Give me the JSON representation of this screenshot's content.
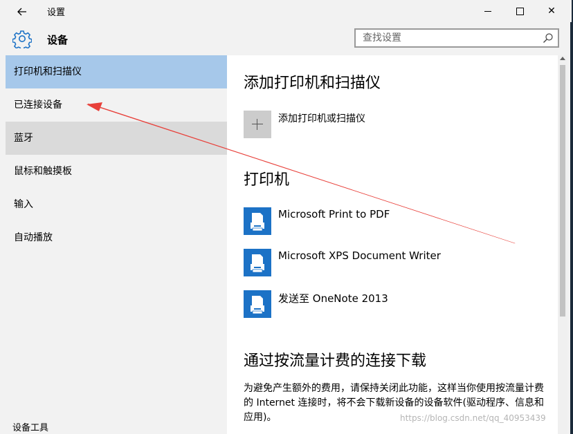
{
  "titlebar": {
    "back_icon": "back-arrow-icon",
    "title": "设置",
    "minimize_icon": "minimize-icon",
    "maximize_icon": "maximize-icon",
    "close_icon": "close-icon",
    "close_glyph": "✕"
  },
  "header": {
    "icon": "gear-icon",
    "title": "设备",
    "search_placeholder": "查找设置",
    "search_icon": "search-icon"
  },
  "sidebar": {
    "items": [
      {
        "label": "打印机和扫描仪",
        "state": "selected"
      },
      {
        "label": "已连接设备",
        "state": "normal"
      },
      {
        "label": "蓝牙",
        "state": "hover"
      },
      {
        "label": "鼠标和触摸板",
        "state": "normal"
      },
      {
        "label": "输入",
        "state": "normal"
      },
      {
        "label": "自动播放",
        "state": "normal"
      }
    ],
    "footer_partial": "设备工具"
  },
  "content": {
    "section1_title": "添加打印机和扫描仪",
    "add_label": "添加打印机或扫描仪",
    "section2_title": "打印机",
    "printers": [
      {
        "name": "Microsoft Print to PDF",
        "icon": "printer-icon"
      },
      {
        "name": "Microsoft XPS Document Writer",
        "icon": "printer-icon"
      },
      {
        "name": "发送至 OneNote 2013",
        "icon": "printer-icon"
      }
    ],
    "section3_title": "通过按流量计费的连接下载",
    "section3_desc": "为避免产生额外的费用，请保持关闭此功能，这样当你使用按流量计费的 Internet 连接时，将不会下载新设备的设备软件(驱动程序、信息和应用)。"
  },
  "watermark": "https://blog.csdn.net/qq_40953439",
  "annotation": {
    "type": "red-arrow",
    "color": "#e8403a",
    "points_to": "已连接设备"
  },
  "colors": {
    "accent": "#1c72c6",
    "selected_bg": "#a6c8ea",
    "hover_bg": "#dadada",
    "sidebar_bg": "#f2f2f2",
    "content_bg": "#ffffff"
  }
}
